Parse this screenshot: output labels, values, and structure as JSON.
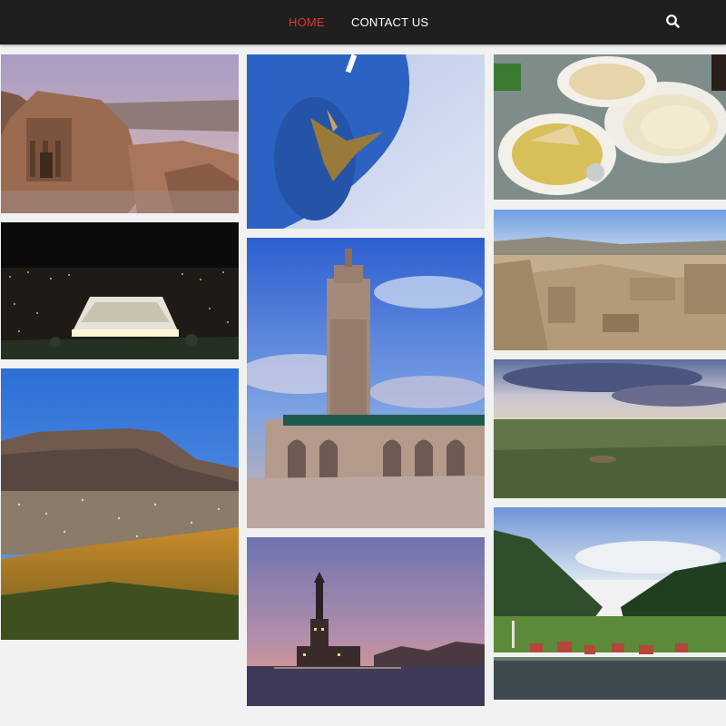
{
  "nav": {
    "links": [
      {
        "label": "HOME",
        "active": true
      },
      {
        "label": "CONTACT US",
        "active": false
      }
    ],
    "search_icon": "search-icon",
    "active_color": "#e8322d",
    "bar_color": "#1f1f1f"
  },
  "gallery": {
    "columns": 3,
    "photos": [
      {
        "subject": "petra-monastery",
        "column": 1,
        "order": 1
      },
      {
        "subject": "amphitheatre-at-night",
        "column": 1,
        "order": 2
      },
      {
        "subject": "table-mountain",
        "column": 1,
        "order": 3
      },
      {
        "subject": "blue-wall-sculpture",
        "column": 2,
        "order": 1
      },
      {
        "subject": "hassan-ii-mosque",
        "column": 2,
        "order": 2
      },
      {
        "subject": "maiden-tower-sunset",
        "column": 2,
        "order": 3
      },
      {
        "subject": "food-plates",
        "column": 3,
        "order": 1
      },
      {
        "subject": "desert-ruins",
        "column": 3,
        "order": 2
      },
      {
        "subject": "green-plain-sunset",
        "column": 3,
        "order": 3
      },
      {
        "subject": "mountain-lake-village",
        "column": 3,
        "order": 4
      }
    ]
  }
}
